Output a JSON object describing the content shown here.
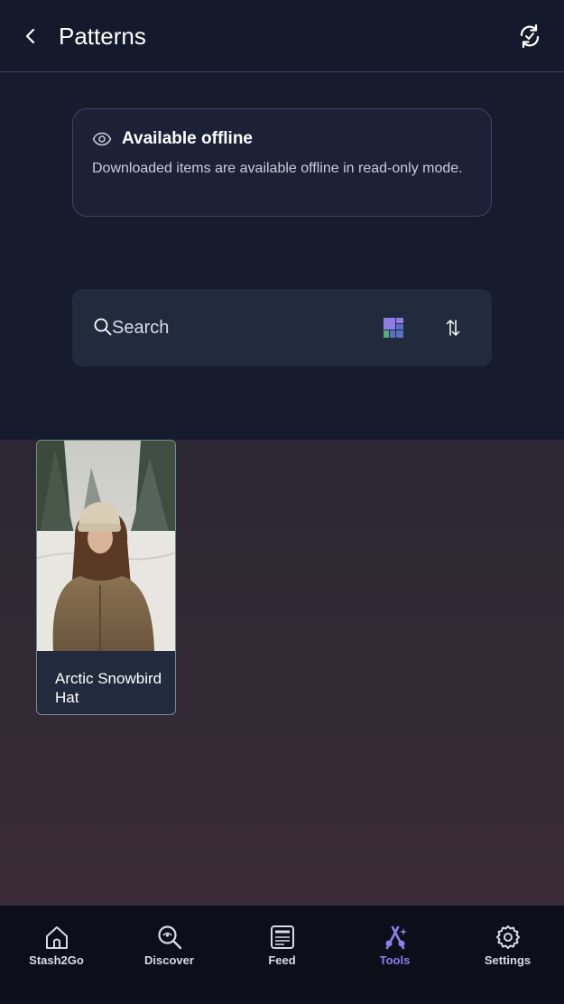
{
  "header": {
    "title": "Patterns",
    "back_icon": "chevron-left-icon",
    "sync_icon": "sync-icon"
  },
  "offline_notice": {
    "title": "Available offline",
    "description": "Downloaded items are available offline in read-only mode.",
    "icon": "eye-icon"
  },
  "search": {
    "placeholder": "Search",
    "value": ""
  },
  "patterns": [
    {
      "name": "Arctic Snowbird Hat"
    }
  ],
  "nav": {
    "items": [
      {
        "label": "Stash2Go",
        "icon": "home-icon",
        "active": false
      },
      {
        "label": "Discover",
        "icon": "discover-search-icon",
        "active": false
      },
      {
        "label": "Feed",
        "icon": "feed-icon",
        "active": false
      },
      {
        "label": "Tools",
        "icon": "tools-icon",
        "active": true
      },
      {
        "label": "Settings",
        "icon": "settings-gear-icon",
        "active": false
      }
    ]
  },
  "colors": {
    "accent": "#8f7de6",
    "background": "#161b2e",
    "card": "#222b3d"
  }
}
